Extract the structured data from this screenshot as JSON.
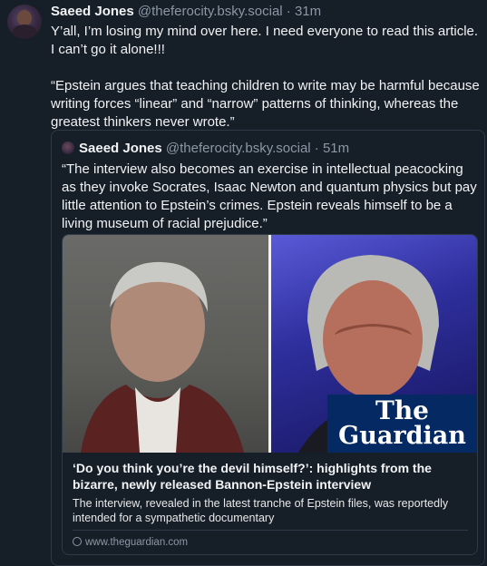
{
  "post": {
    "author_name": "Saeed Jones",
    "author_handle": "@theferocity.bsky.social",
    "separator": "·",
    "time": "31m",
    "paragraphs": [
      "Y’all, I’m losing my mind over here. I need everyone to read this article. I can’t go it alone!!!",
      "“Epstein argues that teaching children to write may be harmful because writing forces “linear” and “narrow” patterns of thinking, whereas the greatest thinkers never wrote.”"
    ]
  },
  "quote": {
    "author_name": "Saeed Jones",
    "author_handle": "@theferocity.bsky.social",
    "separator": "·",
    "time": "51m",
    "text": "“The interview also becomes an exercise in intellectual peacocking as they invoke Socrates, Isaac Newton and quantum physics but pay little attention to Epstein’s crimes. Epstein reveals himself to be a living museum of racial prejudice.”"
  },
  "link_card": {
    "logo_line1": "The",
    "logo_line2": "Guardian",
    "title": "‘Do you think you’re the devil himself?’: highlights from the bizarre, newly released Bannon-Epstein interview",
    "description": "The interview, revealed in the latest tranche of Epstein files, was reportedly intended for a sympathetic documentary",
    "domain": "www.theguardian.com"
  },
  "colors": {
    "background": "#161e27",
    "muted_text": "#8b98a5",
    "guardian_blue": "#052962"
  }
}
